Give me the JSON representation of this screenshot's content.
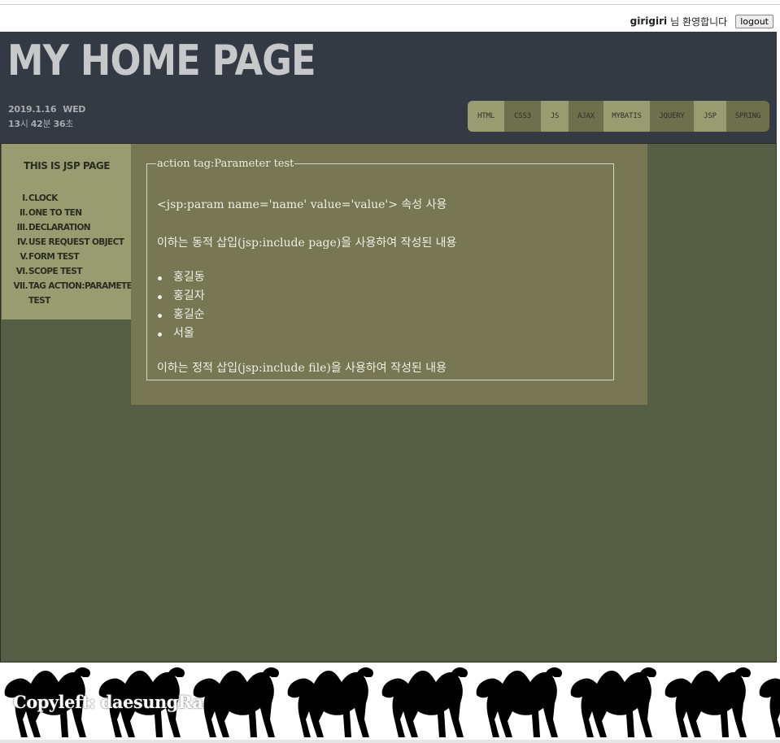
{
  "user": {
    "name": "girigiri",
    "welcome": "님 환영합니다",
    "logout_label": "logout"
  },
  "header": {
    "title": "MY HOME PAGE",
    "date": "2019.1.16",
    "weekday": "WED",
    "time": {
      "hour": "13",
      "hour_unit": "시",
      "minute": "42",
      "minute_unit": "분",
      "second": "36",
      "second_unit": "초"
    }
  },
  "nav": {
    "items": [
      {
        "label": "HTML",
        "shade": "light"
      },
      {
        "label": "CSS3",
        "shade": "dark"
      },
      {
        "label": "JS",
        "shade": "light"
      },
      {
        "label": "AJAX",
        "shade": "dark"
      },
      {
        "label": "MYBATIS",
        "shade": "light"
      },
      {
        "label": "JQUERY",
        "shade": "dark"
      },
      {
        "label": "JSP",
        "shade": "light"
      },
      {
        "label": "SPRING",
        "shade": "dark"
      }
    ]
  },
  "sidebar": {
    "title": "THIS IS JSP PAGE",
    "items": [
      {
        "num": "I.",
        "label": "CLOCK"
      },
      {
        "num": "II.",
        "label": "ONE TO TEN"
      },
      {
        "num": "III.",
        "label": "DECLARATION"
      },
      {
        "num": "IV.",
        "label": "USE REQUEST OBJECT"
      },
      {
        "num": "V.",
        "label": "FORM TEST"
      },
      {
        "num": "VI.",
        "label": "SCOPE TEST"
      },
      {
        "num": "VII.",
        "label": "TAG ACTION:PARAMETER"
      },
      {
        "num": "",
        "label": "TEST"
      }
    ]
  },
  "content": {
    "legend": "action tag:Parameter test",
    "intro": "<jsp:param name='name' value='value'> 속성 사용",
    "dynamic_note": "이하는 동적 삽입(jsp:include page)을 사용하여 작성된 내용",
    "names": [
      "홍길동",
      "홍길자",
      "홍길순",
      "서울"
    ],
    "static_note": "이하는 정적 삽입(jsp:include file)을 사용하여 작성된 내용"
  },
  "footer": {
    "copyleft": "Copyleft: daesungRa"
  },
  "colors": {
    "header_bg": "#343a44",
    "main_bg": "#565f45",
    "sidebar_bg": "#999b70",
    "content_bg": "#777753",
    "nav_light": "#999b70",
    "nav_dark": "#6e6f4c"
  }
}
